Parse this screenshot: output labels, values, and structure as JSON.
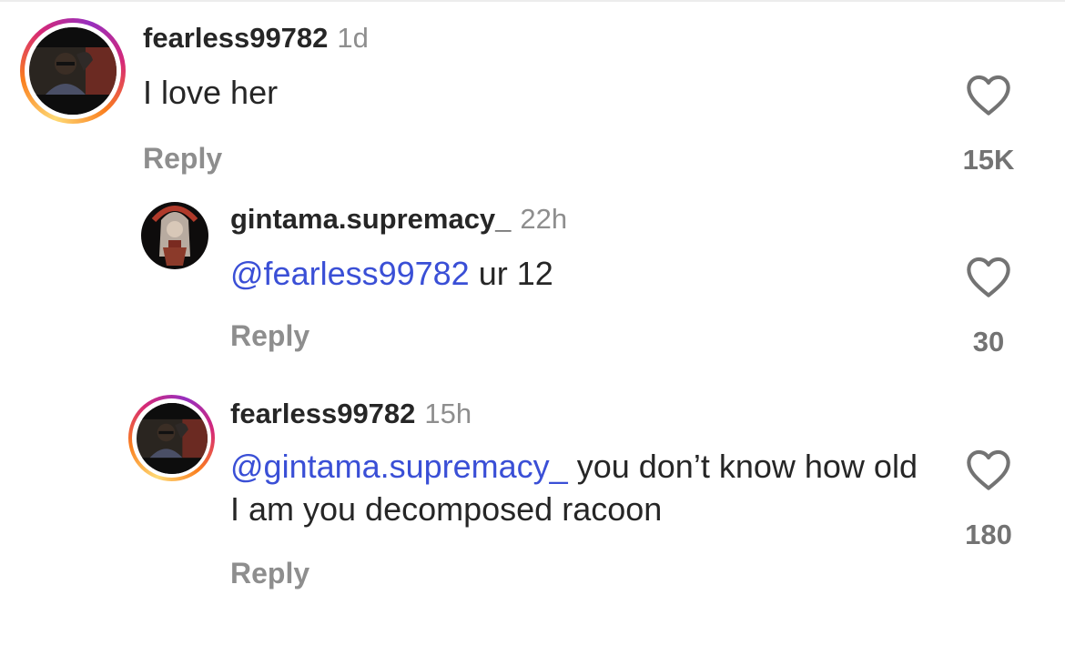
{
  "comments": [
    {
      "username": "fearless99782",
      "time": "1d",
      "text": "I love her",
      "mention": "",
      "reply_label": "Reply",
      "likes": "15K",
      "has_story_ring": true
    },
    {
      "username": "gintama.supremacy_",
      "time": "22h",
      "mention": "@fearless99782",
      "text": " ur 12",
      "reply_label": "Reply",
      "likes": "30",
      "has_story_ring": false
    },
    {
      "username": "fearless99782",
      "time": "15h",
      "mention": "@gintama.supremacy_",
      "text": " you don’t know how old I am you decomposed racoon",
      "reply_label": "Reply",
      "likes": "180",
      "has_story_ring": true
    }
  ],
  "icons": {
    "like": "heart-outline-icon"
  },
  "colors": {
    "mention": "#3a4fd6",
    "secondary_text": "#8e8e8e",
    "story_ring": [
      "#feda75",
      "#fa7e1e",
      "#d62976",
      "#962fbf"
    ]
  }
}
